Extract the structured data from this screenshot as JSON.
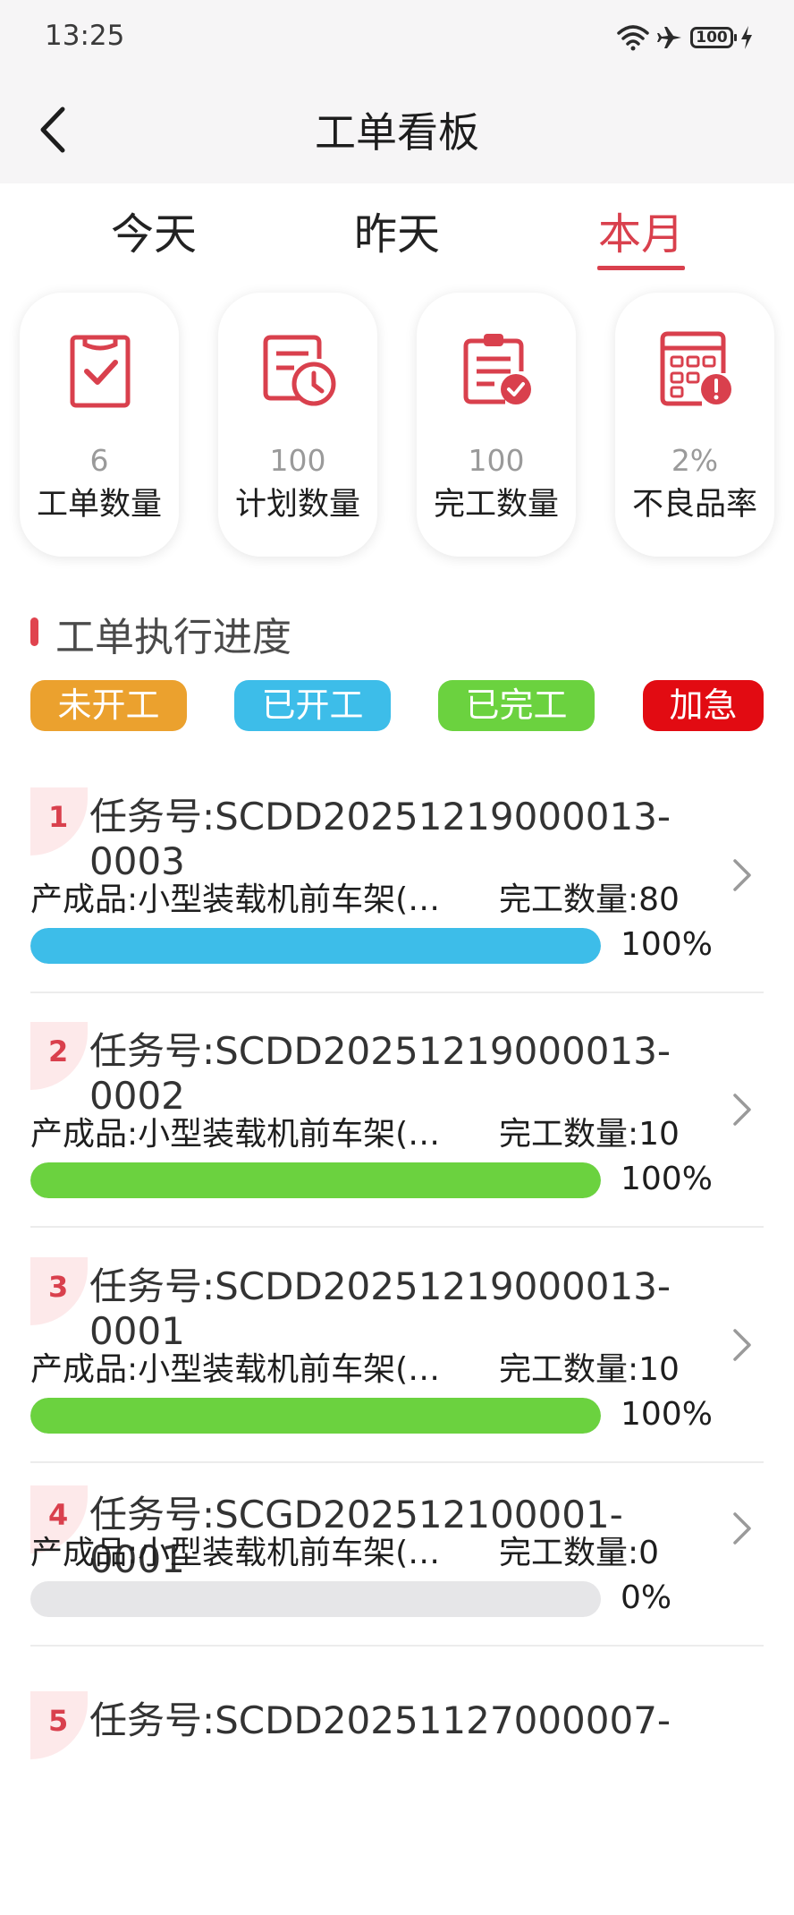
{
  "status_bar": {
    "time": "13:25",
    "battery": "100"
  },
  "header": {
    "title": "工单看板"
  },
  "tabs": [
    {
      "label": "今天",
      "active": false
    },
    {
      "label": "昨天",
      "active": false
    },
    {
      "label": "本月",
      "active": true
    }
  ],
  "stats": [
    {
      "icon": "clipboard-check-icon",
      "value": "6",
      "label": "工单数量"
    },
    {
      "icon": "calendar-clock-icon",
      "value": "100",
      "label": "计划数量"
    },
    {
      "icon": "clipboard-done-icon",
      "value": "100",
      "label": "完工数量"
    },
    {
      "icon": "calendar-alert-icon",
      "value": "2%",
      "label": "不良品率"
    }
  ],
  "section": {
    "title": "工单执行进度"
  },
  "legend": [
    {
      "label": "未开工",
      "color": "#eba12e"
    },
    {
      "label": "已开工",
      "color": "#3dbde9"
    },
    {
      "label": "已完工",
      "color": "#6bd23f"
    },
    {
      "label": "加急",
      "color": "#e20b12"
    }
  ],
  "orders": [
    {
      "index": "1",
      "task_line1": "任务号:SCDD20251219000013-",
      "task_line2": "0003",
      "product": "产成品:小型装载机前车架(…",
      "done": "完工数量:80",
      "percent_text": "100%",
      "progress": 1.0,
      "color": "#3dbde9"
    },
    {
      "index": "2",
      "task_line1": "任务号:SCDD20251219000013-",
      "task_line2": "0002",
      "product": "产成品:小型装载机前车架(…",
      "done": "完工数量:10",
      "percent_text": "100%",
      "progress": 1.0,
      "color": "#6bd23f"
    },
    {
      "index": "3",
      "task_line1": "任务号:SCDD20251219000013-",
      "task_line2": "0001",
      "product": "产成品:小型装载机前车架(…",
      "done": "完工数量:10",
      "percent_text": "100%",
      "progress": 1.0,
      "color": "#6bd23f"
    },
    {
      "index": "4",
      "task_line1": "任务号:SCGD202512100001-0001",
      "task_line2": "",
      "product": "产成品:小型装载机前车架(…",
      "done": "完工数量:0",
      "percent_text": "0%",
      "progress": 0.0,
      "color": "#e6e6e8"
    },
    {
      "index": "5",
      "task_line1": "任务号:SCDD20251127000007-",
      "task_line2": "",
      "product": "",
      "done": "",
      "percent_text": "",
      "progress": 0.0,
      "color": "#e6e6e8"
    }
  ]
}
